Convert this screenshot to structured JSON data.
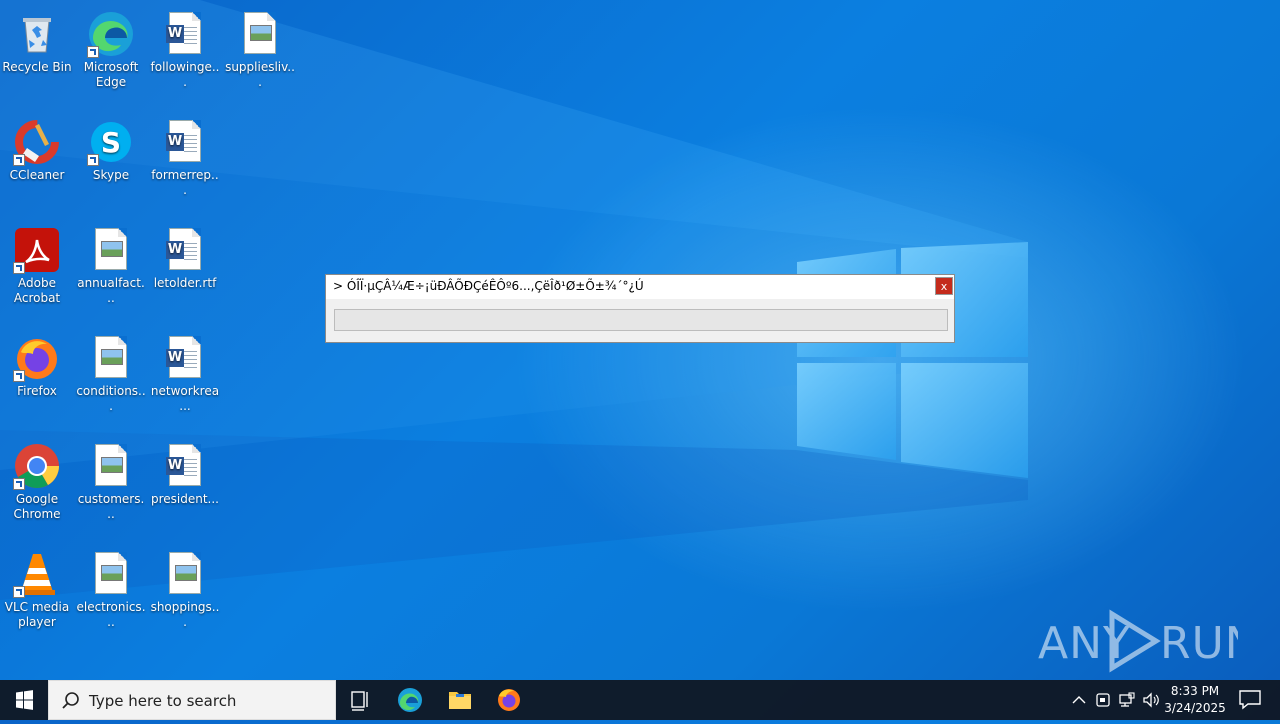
{
  "desktop": {
    "icons": [
      {
        "label": "Recycle Bin"
      },
      {
        "label": "Microsoft Edge"
      },
      {
        "label": "followinge..."
      },
      {
        "label": "suppliesliv..."
      },
      {
        "label": "CCleaner"
      },
      {
        "label": "Skype"
      },
      {
        "label": "formerrep..."
      },
      {
        "label": "Adobe Acrobat"
      },
      {
        "label": "annualfact..."
      },
      {
        "label": "letolder.rtf"
      },
      {
        "label": "Firefox"
      },
      {
        "label": "conditions..."
      },
      {
        "label": "networkrea..."
      },
      {
        "label": "Google Chrome"
      },
      {
        "label": "customers..."
      },
      {
        "label": "president..."
      },
      {
        "label": "VLC media player"
      },
      {
        "label": "electronics..."
      },
      {
        "label": "shoppings..."
      }
    ]
  },
  "dialog": {
    "title": "> ÓÎÏ·µÇÂ¼Æ÷¡üÐÂÕÐÇéÊÔº6...,ÇëÎð¹Ø±Õ±¾´°¿Ú",
    "close_label": "x",
    "progress": 0
  },
  "taskbar": {
    "search_placeholder": "Type here to search",
    "time": "8:33 PM",
    "date": "3/24/2025"
  },
  "watermark": {
    "text": "ANY RUN"
  },
  "colors": {
    "accent": "#0078d7",
    "close": "#c42b1c"
  }
}
